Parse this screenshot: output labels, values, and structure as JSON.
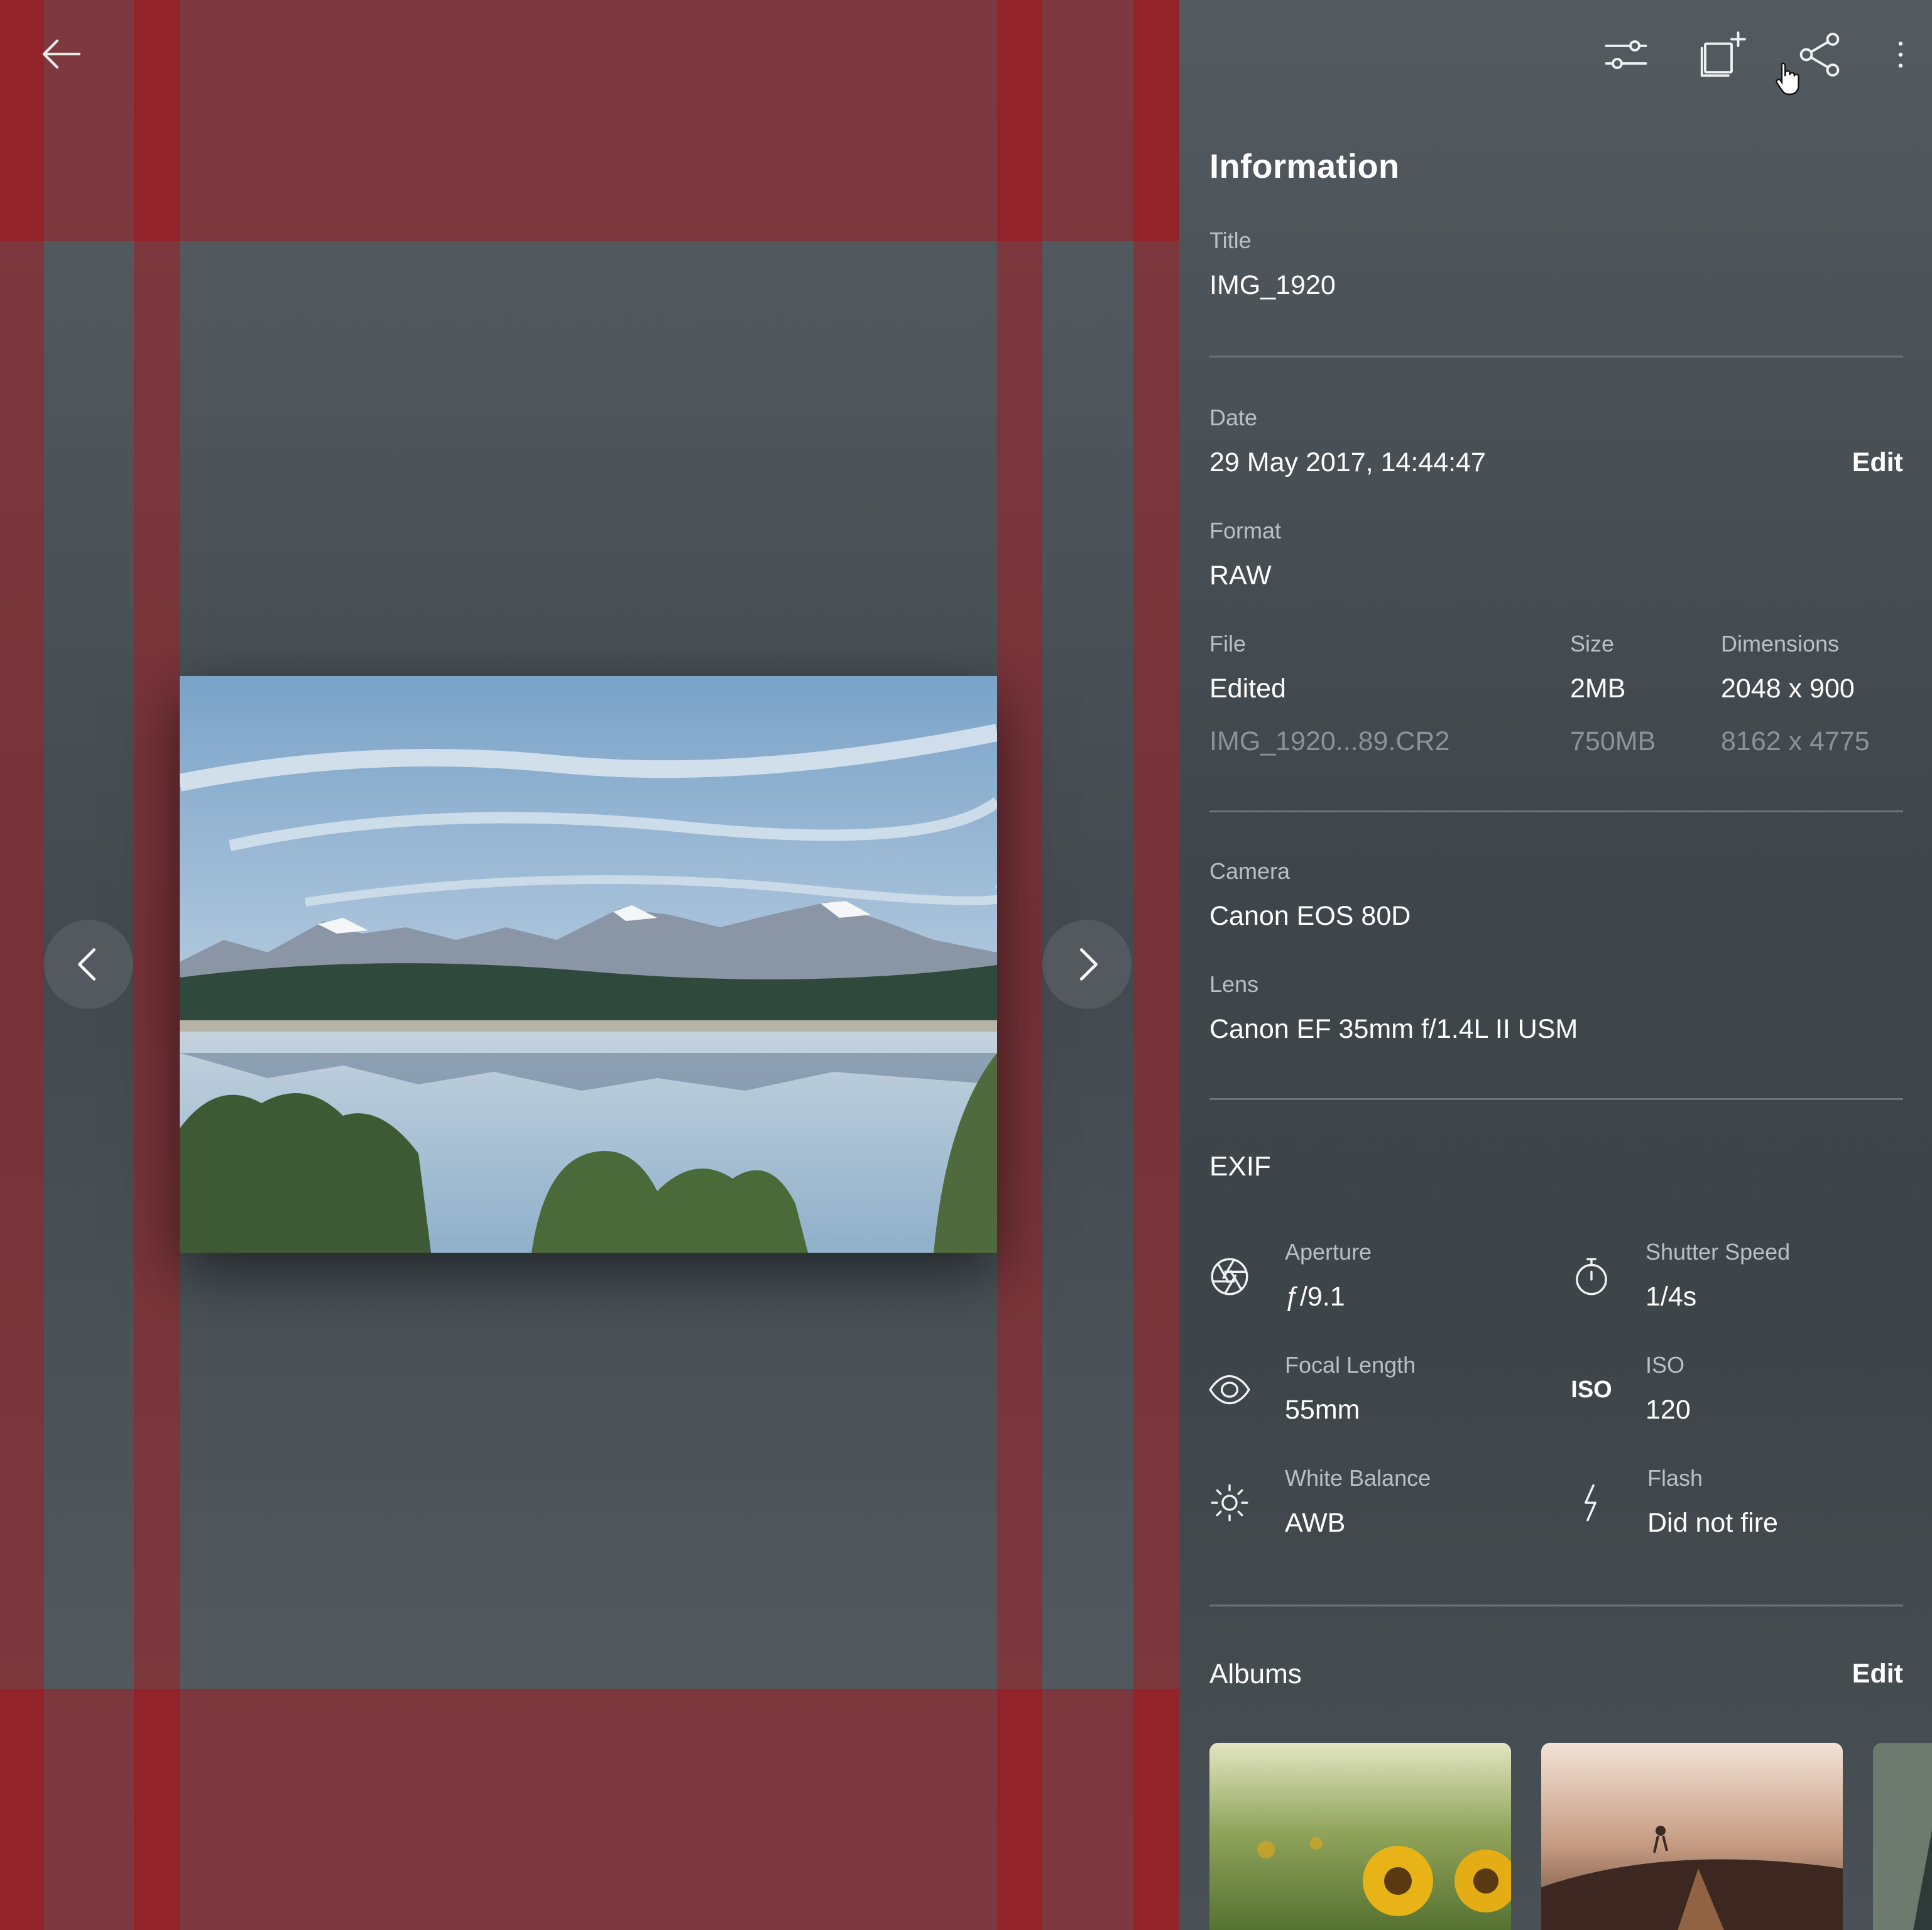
{
  "toolbar": {
    "adjust_icon": "sliders-icon",
    "add_to_album_icon": "add-to-album-icon",
    "share_icon": "share-icon",
    "more_icon": "more-vertical-icon"
  },
  "viewer": {
    "back_icon": "arrow-left-icon",
    "prev_icon": "chevron-left-icon",
    "next_icon": "chevron-right-icon"
  },
  "info": {
    "heading": "Information",
    "title_label": "Title",
    "title_value": "IMG_1920",
    "date_label": "Date",
    "date_value": "29 May 2017, 14:44:47",
    "date_edit": "Edit",
    "format_label": "Format",
    "format_value": "RAW",
    "file_label": "File",
    "size_label": "Size",
    "dimensions_label": "Dimensions",
    "files": [
      {
        "file": "Edited",
        "size": "2MB",
        "dimensions": "2048 x 900"
      },
      {
        "file": "IMG_1920...89.CR2",
        "size": "750MB",
        "dimensions": "8162 x 4775"
      }
    ],
    "camera_label": "Camera",
    "camera_value": "Canon EOS 80D",
    "lens_label": "Lens",
    "lens_value": "Canon EF 35mm f/1.4L II USM"
  },
  "exif": {
    "heading": "EXIF",
    "aperture_label": "Aperture",
    "aperture_value": "ƒ/9.1",
    "shutter_label": "Shutter Speed",
    "shutter_value": "1/4s",
    "focal_label": "Focal Length",
    "focal_value": "55mm",
    "iso_icon_text": "ISO",
    "iso_label": "ISO",
    "iso_value": "120",
    "wb_label": "White Balance",
    "wb_value": "AWB",
    "flash_label": "Flash",
    "flash_value": "Did not fire"
  },
  "albums": {
    "heading": "Albums",
    "edit": "Edit"
  },
  "colors": {
    "panel_bg": "#464d52",
    "guide_red": "#96242a",
    "divider": "#6d7478"
  }
}
